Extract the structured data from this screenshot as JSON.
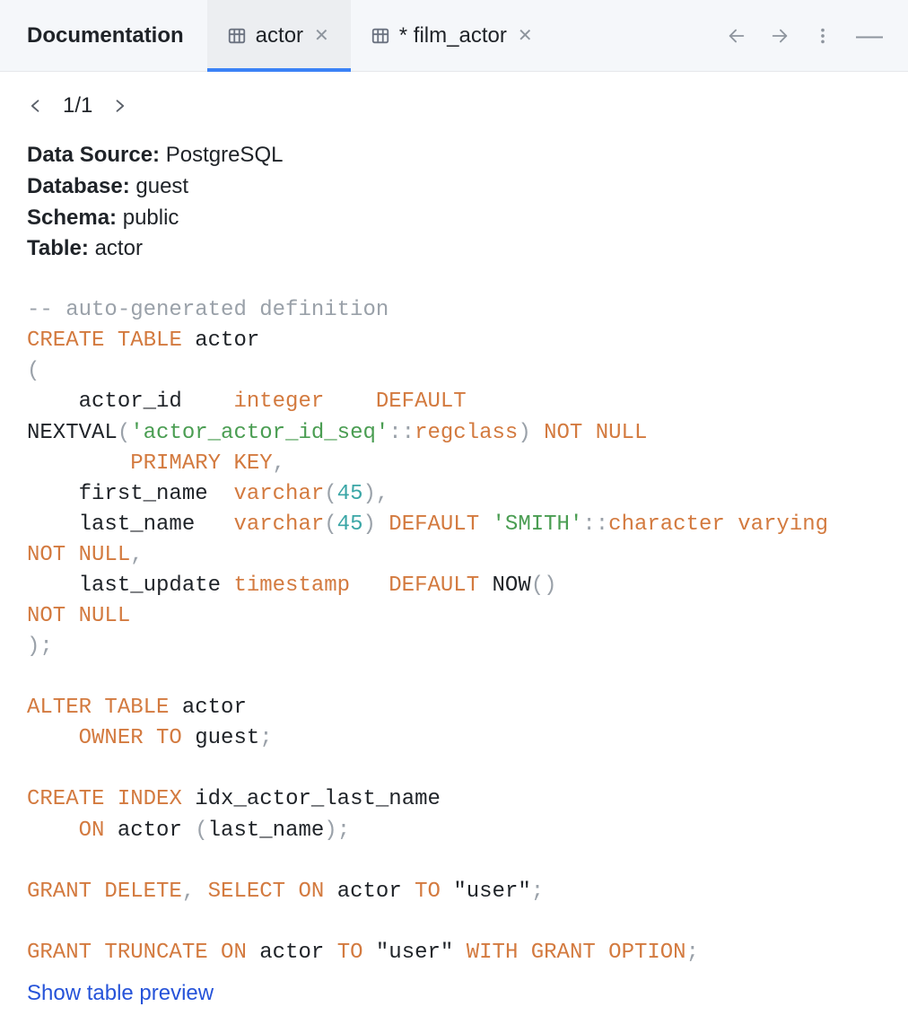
{
  "tabs": {
    "documentation": "Documentation",
    "actor": "actor",
    "film_actor": "* film_actor"
  },
  "pager": {
    "position": "1/1"
  },
  "meta": {
    "datasource_label": "Data Source:",
    "datasource_value": "PostgreSQL",
    "database_label": "Database:",
    "database_value": "guest",
    "schema_label": "Schema:",
    "schema_value": "public",
    "table_label": "Table:",
    "table_value": "actor"
  },
  "sql": {
    "comment": "-- auto-generated definition",
    "create": "CREATE",
    "table": "TABLE",
    "actor": "actor",
    "lparen": "(",
    "col_actorid_pad": "    actor_id    ",
    "integer": "integer",
    "gap1": "    ",
    "default": "DEFAULT",
    "nextval_fn": "NEXTVAL",
    "nextval_l": "(",
    "nextval_str": "'actor_actor_id_seq'",
    "cast": "::",
    "regclass": "regclass",
    "nextval_r": ")",
    "sp": " ",
    "not": "NOT",
    "null": "NULL",
    "pk_pad": "        ",
    "primary": "PRIMARY",
    "key": "KEY",
    "comma": ",",
    "col_first_pad": "    first_name  ",
    "varchar": "varchar",
    "varchar_l": "(",
    "n45": "45",
    "varchar_r": ")",
    "col_last_pad": "    last_name   ",
    "smith": "'SMITH'",
    "character": "character",
    "varying": "varying",
    "notnull_pad1": "                ",
    "col_update_pad": "    last_update ",
    "timestamp": "timestamp",
    "gap2": "   ",
    "now_fn": "NOW",
    "now_l": "(",
    "now_r": ")",
    "notnull_pad2": "                                      ",
    "rparen": ")",
    "semi": ";",
    "alter": "ALTER",
    "owner_pad": "    ",
    "owner": "OWNER",
    "to": "TO",
    "guest": "guest",
    "index": "INDEX",
    "idx_name": "idx_actor_last_name",
    "on_pad": "    ",
    "on": "ON",
    "col_lastname": "last_name",
    "grant": "GRANT",
    "delete": "DELETE",
    "select": "SELECT",
    "user_q": "\"user\"",
    "truncate": "TRUNCATE",
    "with": "WITH",
    "option": "OPTION"
  },
  "link": {
    "show_preview": "Show table preview"
  }
}
